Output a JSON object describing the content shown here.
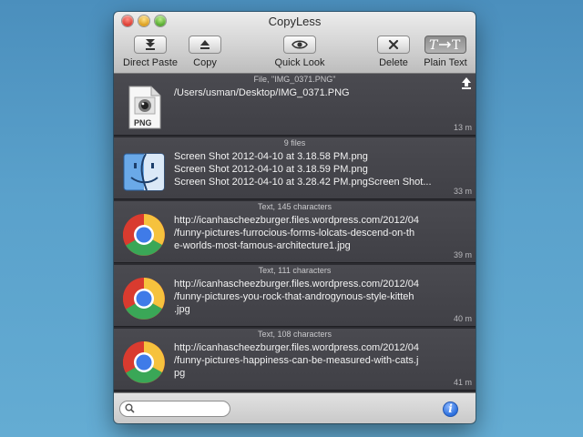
{
  "window": {
    "title": "CopyLess"
  },
  "toolbar": {
    "items": [
      {
        "label": "Direct Paste",
        "icon": "direct-paste-icon"
      },
      {
        "label": "Copy",
        "icon": "eject-copy-icon"
      },
      {
        "label": "Quick Look",
        "icon": "eye-icon"
      },
      {
        "label": "Delete",
        "icon": "x-delete-icon"
      },
      {
        "label": "Plain Text",
        "icon": "plain-text-icon",
        "pressed": true
      }
    ]
  },
  "clips": [
    {
      "header": "File, \"IMG_0371.PNG\"",
      "lines": [
        "/Users/usman/Desktop/IMG_0371.PNG"
      ],
      "time": "13 m",
      "icon": "png-file-icon",
      "has_upload": true
    },
    {
      "header": "9 files",
      "lines": [
        "Screen Shot 2012-04-10 at 3.18.58 PM.png",
        "Screen Shot 2012-04-10 at 3.18.59 PM.png",
        "Screen Shot 2012-04-10 at 3.28.42 PM.pngScreen Shot..."
      ],
      "time": "33 m",
      "icon": "finder-icon"
    },
    {
      "header": "Text, 145 characters",
      "lines": [
        "http://icanhascheezburger.files.wordpress.com/2012/04",
        "/funny-pictures-furrocious-forms-lolcats-descend-on-th",
        "e-worlds-most-famous-architecture1.jpg"
      ],
      "time": "39 m",
      "icon": "chrome-icon"
    },
    {
      "header": "Text, 111 characters",
      "lines": [
        "http://icanhascheezburger.files.wordpress.com/2012/04",
        "/funny-pictures-you-rock-that-androgynous-style-kitteh",
        ".jpg"
      ],
      "time": "40 m",
      "icon": "chrome-icon"
    },
    {
      "header": "Text, 108 characters",
      "lines": [
        "http://icanhascheezburger.files.wordpress.com/2012/04",
        "/funny-pictures-happiness-can-be-measured-with-cats.j",
        "pg"
      ],
      "time": "41 m",
      "icon": "chrome-icon"
    }
  ],
  "search": {
    "value": "",
    "placeholder": ""
  },
  "colors": {
    "desktop": "#5aa1cb",
    "list_bg": "#404046",
    "accent": "#2b6fdd"
  }
}
